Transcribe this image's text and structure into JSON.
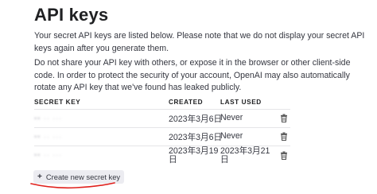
{
  "page": {
    "title": "API keys",
    "paragraph_1": "Your secret API keys are listed below. Please note that we do not display your secret API keys again after you generate them.",
    "paragraph_2": "Do not share your API key with others, or expose it in the browser or other client-side code. In order to protect the security of your account, OpenAI may also automatically rotate any API key that we've found has leaked publicly."
  },
  "table": {
    "headers": {
      "secret_key": "SECRET KEY",
      "created": "CREATED",
      "last_used": "LAST USED"
    },
    "rows": [
      {
        "created": "2023年3月6日",
        "last_used": "Never"
      },
      {
        "created": "2023年3月6日",
        "last_used": "Never"
      },
      {
        "created_line1": "2023年3月19",
        "created_line2": "日",
        "last_used_line1": "2023年3月21",
        "last_used_line2": "日"
      }
    ],
    "delete_icon": "trash-icon"
  },
  "actions": {
    "create_label": "Create new secret key",
    "create_icon": "plus-icon"
  },
  "colors": {
    "text": "#353740",
    "heading": "#202123",
    "button_bg": "#ececf1",
    "annotation_red": "#e0201c"
  }
}
